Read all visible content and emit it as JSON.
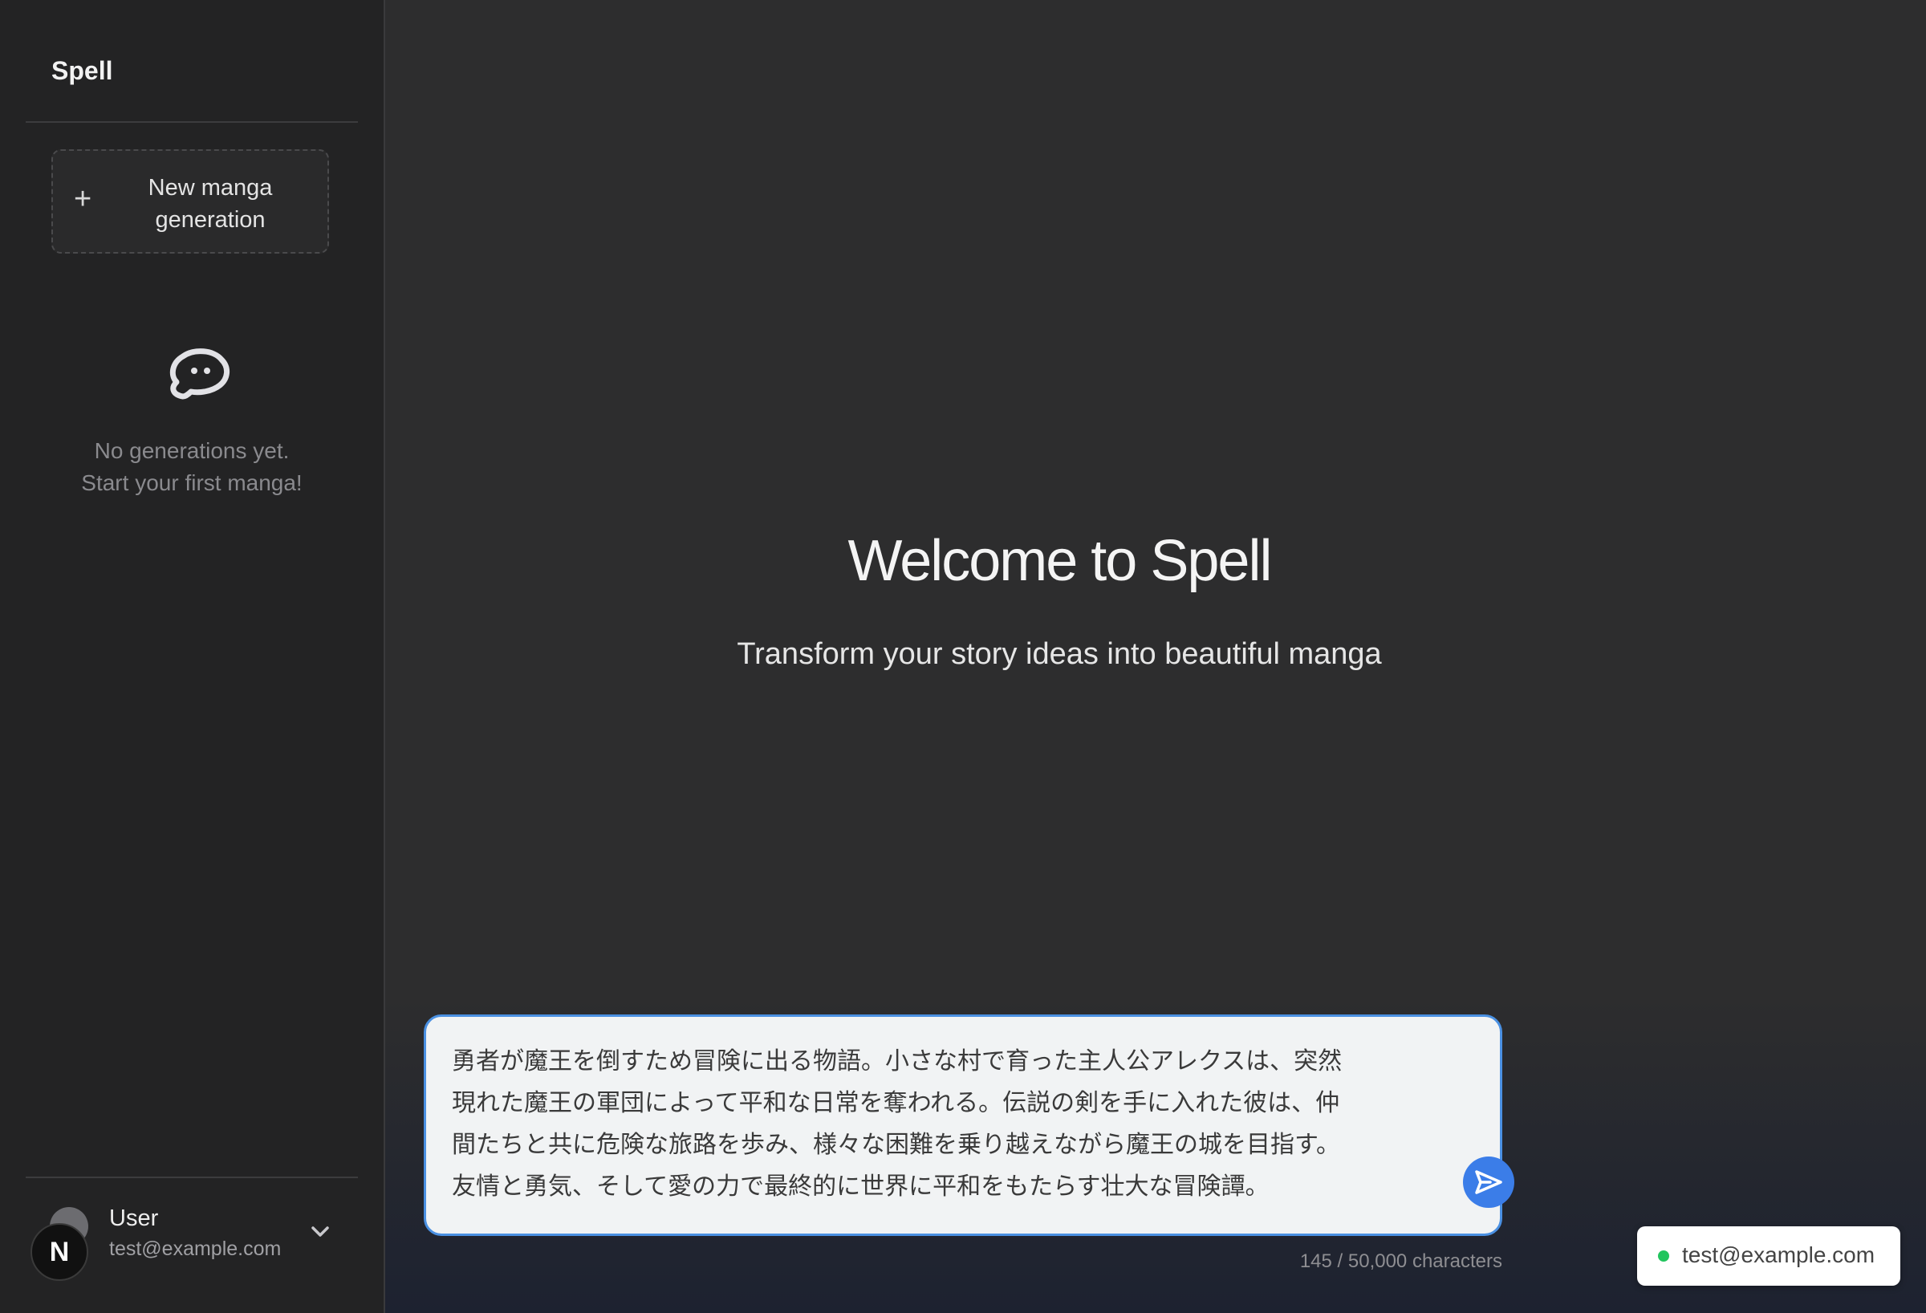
{
  "sidebar": {
    "brand": "Spell",
    "new_button_label": "New manga generation",
    "new_button_icon": "plus-icon",
    "empty_icon": "chat-bubble-face-icon",
    "empty_line1": "No generations yet.",
    "empty_line2": "Start your first manga!",
    "user": {
      "name": "User",
      "email": "test@example.com",
      "menu_icon": "chevron-down-icon"
    },
    "badge_letter": "N"
  },
  "main": {
    "title": "Welcome to Spell",
    "subtitle": "Transform your story ideas into beautiful manga",
    "prompt": {
      "value": "勇者が魔王を倒すため冒険に出る物語。小さな村で育った主人公アレクスは、突然\n現れた魔王の軍団によって平和な日常を奪われる。伝説の剣を手に入れた彼は、仲\n間たちと共に危険な旅路を歩み、様々な困難を乗り越えながら魔王の城を目指す。\n友情と勇気、そして愛の力で最終的に世界に平和をもたらす壮大な冒険譚。",
      "send_icon": "send-icon"
    },
    "char_count": "145 / 50,000 characters"
  },
  "toast": {
    "text": "test@example.com",
    "status_color": "#22c55e"
  },
  "colors": {
    "accent": "#3b7de8",
    "sidebar_bg": "#232324",
    "main_bg": "#2d2d2e"
  }
}
